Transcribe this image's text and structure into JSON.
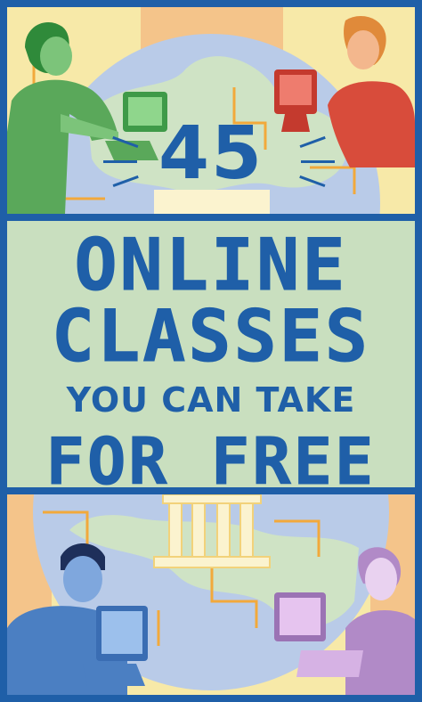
{
  "headline": {
    "number": "45",
    "line1": "ONLINE",
    "line2": "CLASSES",
    "line3": "YOU CAN TAKE",
    "line4": "FOR FREE"
  },
  "colors": {
    "frame": "#1f5fa8",
    "title_band": "#c9dfbf",
    "background": "#f7e9a8",
    "globe": "#b9cbe8",
    "land": "#cfe3c5",
    "woman_green": "#5aa85a",
    "man_red": "#d84c3b",
    "man_blue": "#4b7fc2",
    "woman_purple": "#b18ac7"
  },
  "illustrations": [
    "woman-at-computer-green",
    "man-at-computer-red",
    "man-at-computer-blue",
    "woman-at-computer-purple",
    "classical-building-icon",
    "globe-icon",
    "circuit-lines"
  ]
}
